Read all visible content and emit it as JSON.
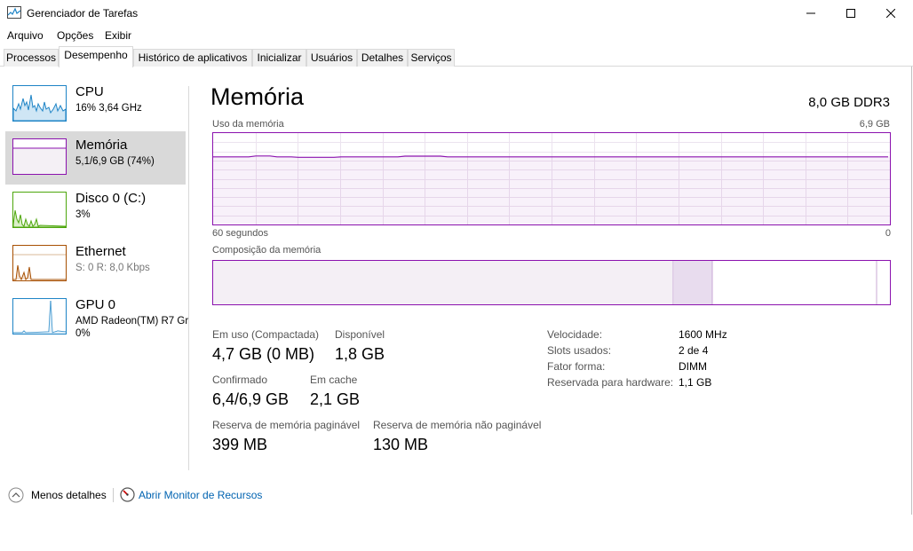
{
  "window": {
    "title": "Gerenciador de Tarefas"
  },
  "menu": [
    "Arquivo",
    "Opções",
    "Exibir"
  ],
  "tabs": [
    "Processos",
    "Desempenho",
    "Histórico de aplicativos",
    "Inicializar",
    "Usuários",
    "Detalhes",
    "Serviços"
  ],
  "active_tab": "Desempenho",
  "sidebar": [
    {
      "name": "CPU",
      "sub": "16%  3,64 GHz",
      "color": "#1e84c6"
    },
    {
      "name": "Memória",
      "sub": "5,1/6,9 GB (74%)",
      "color": "#8b12ae"
    },
    {
      "name": "Disco 0 (C:)",
      "sub": "3%",
      "color": "#4da60c"
    },
    {
      "name": "Ethernet",
      "sub_s": "S: 0",
      "sub_r": "R: 8,0 Kbps",
      "color": "#a74f01"
    },
    {
      "name": "GPU 0",
      "sub": "AMD Radeon(TM) R7 Gr",
      "sub2": "0%",
      "color": "#1e84c6"
    }
  ],
  "main": {
    "title": "Memória",
    "spec": "8,0 GB DDR3",
    "usage_label": "Uso da memória",
    "usage_max": "6,9 GB",
    "time_left": "60 segundos",
    "time_right": "0",
    "composition_label": "Composição da memória",
    "usage_level": 0.74,
    "stats": {
      "in_use_label": "Em uso (Compactada)",
      "in_use_value": "4,7 GB (0 MB)",
      "available_label": "Disponível",
      "available_value": "1,8 GB",
      "committed_label": "Confirmado",
      "committed_value": "6,4/6,9 GB",
      "cached_label": "Em cache",
      "cached_value": "2,1 GB",
      "paged_label": "Reserva de memória paginável",
      "paged_value": "399 MB",
      "nonpaged_label": "Reserva de memória não paginável",
      "nonpaged_value": "130 MB"
    },
    "specs": [
      {
        "label": "Velocidade:",
        "value": "1600 MHz"
      },
      {
        "label": "Slots usados:",
        "value": "2 de 4"
      },
      {
        "label": "Fator forma:",
        "value": "DIMM"
      },
      {
        "label": "Reservada para hardware:",
        "value": "1,1 GB"
      }
    ]
  },
  "footer": {
    "less_details": "Menos detalhes",
    "resource_monitor": "Abrir Monitor de Recursos"
  },
  "colors": {
    "memory": "#8b12ae",
    "link": "#0063b1"
  }
}
